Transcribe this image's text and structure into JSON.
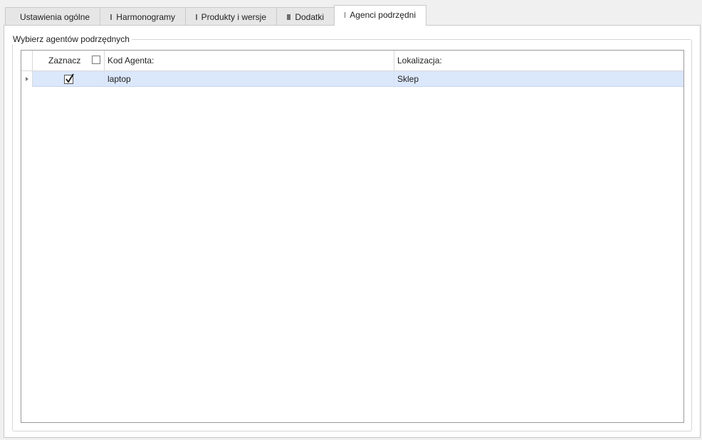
{
  "tabs": [
    {
      "label": "Ustawienia ogólne",
      "active": false
    },
    {
      "label": "Harmonogramy",
      "active": false
    },
    {
      "label": "Produkty i wersje",
      "active": false
    },
    {
      "label": "Dodatki",
      "active": false
    },
    {
      "label": "Agenci podrzędni",
      "active": true
    }
  ],
  "groupbox": {
    "title": "Wybierz agentów podrzędnych"
  },
  "grid": {
    "columns": {
      "check": "Zaznacz",
      "kod": "Kod Agenta:",
      "lokalizacja": "Lokalizacja:"
    },
    "header_checkbox_checked": false,
    "rows": [
      {
        "checked": true,
        "kod": "laptop",
        "lokalizacja": "Sklep",
        "selected": true
      }
    ]
  },
  "colors": {
    "selected_row": "#dbe7fb",
    "tab_inactive": "#e6e6e6",
    "tab_active": "#ffffff"
  },
  "icons": {
    "tab_marker": "square-icon",
    "row_indicator": "row-arrow-icon",
    "check_mark": "checkmark-icon"
  }
}
